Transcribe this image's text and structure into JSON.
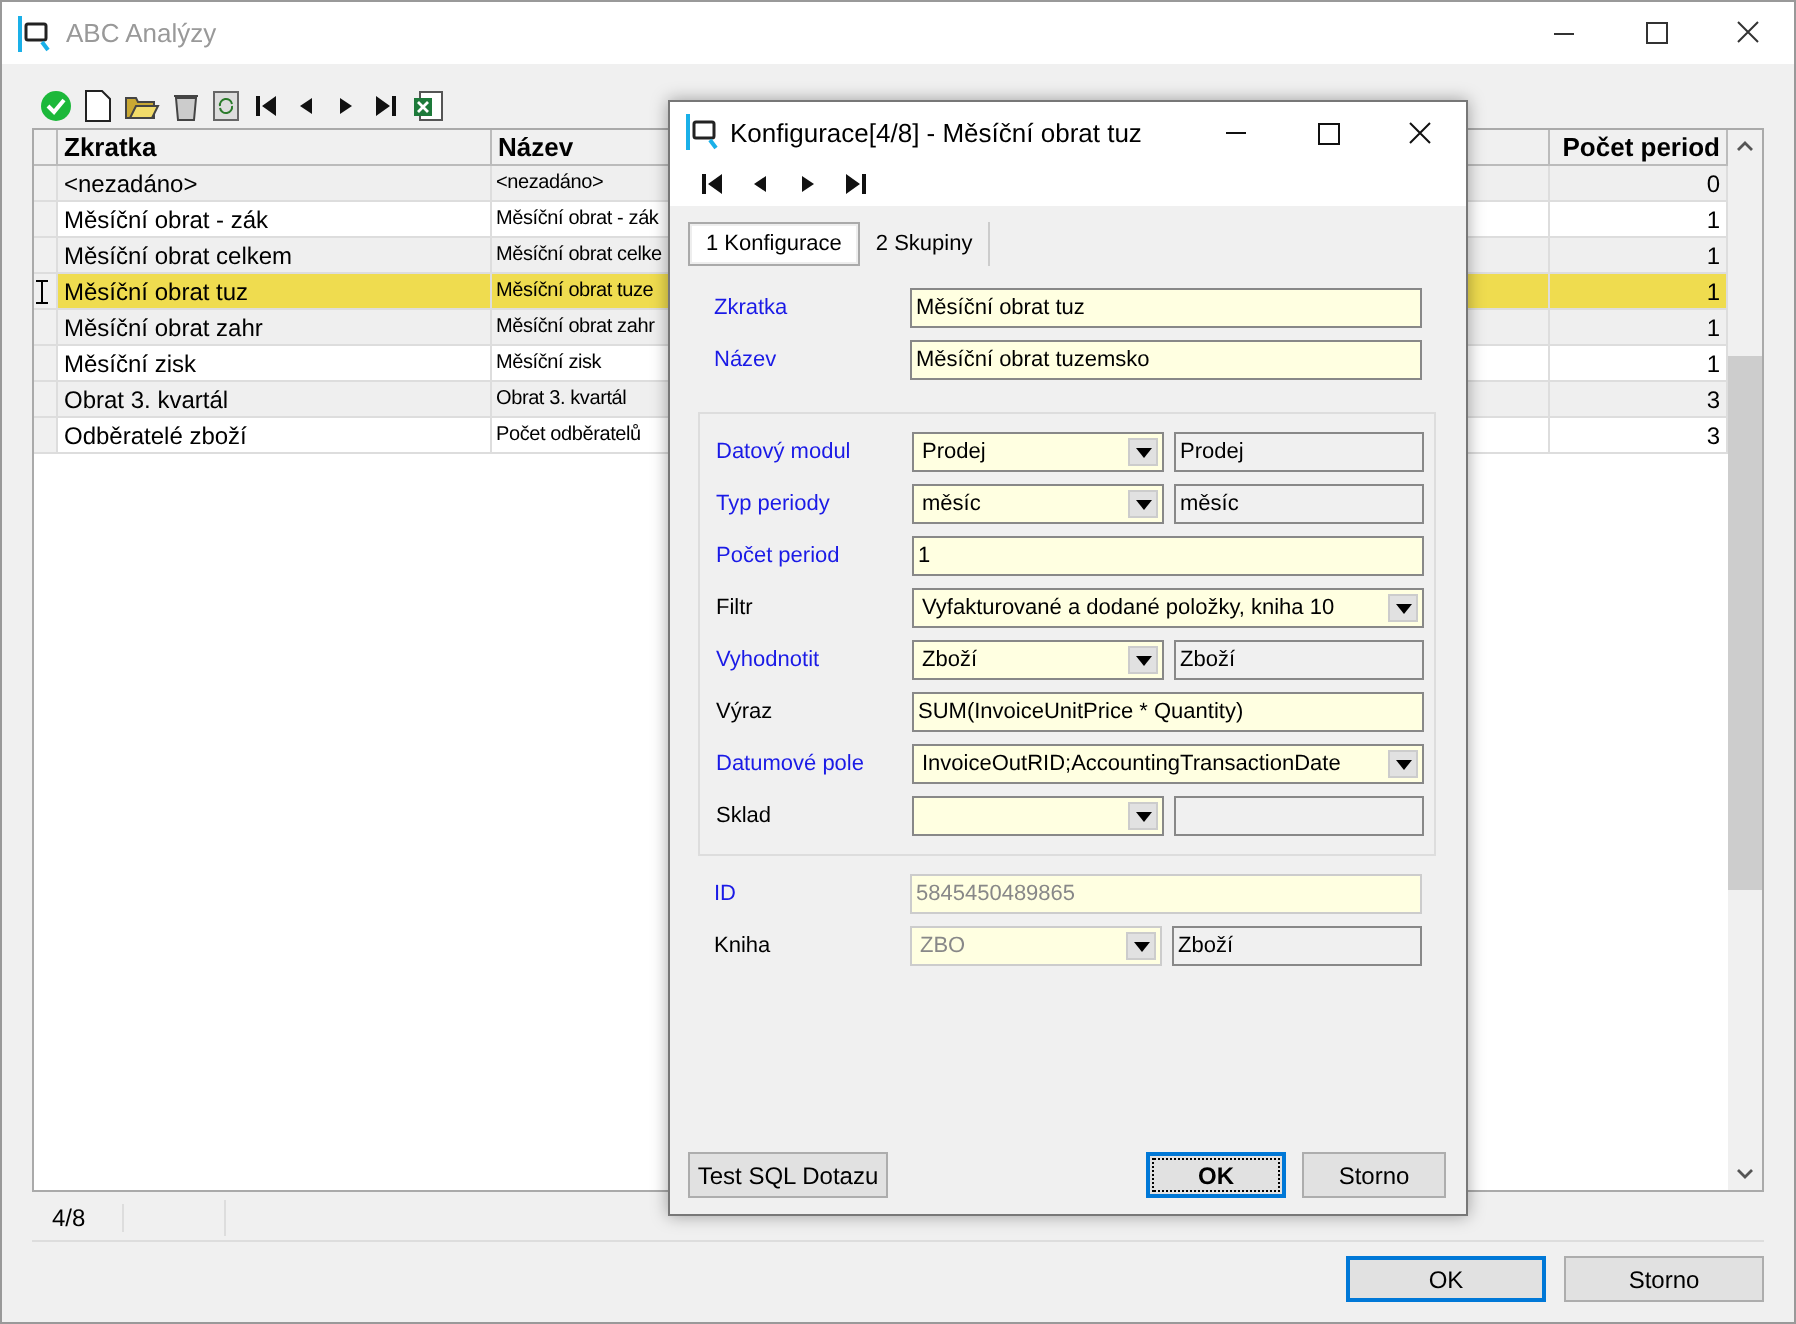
{
  "window": {
    "title": "ABC Analýzy"
  },
  "table": {
    "columns": [
      "Zkratka",
      "Název",
      "Počet period"
    ],
    "rows": [
      {
        "zkratka": "<nezadáno>",
        "nazev": "<nezadáno>",
        "pocet": "0",
        "selected": false
      },
      {
        "zkratka": "Měsíční obrat - zák",
        "nazev": "Měsíční obrat - zák",
        "pocet": "1",
        "selected": false
      },
      {
        "zkratka": "Měsíční obrat celkem",
        "nazev": "Měsíční obrat celke",
        "pocet": "1",
        "selected": false
      },
      {
        "zkratka": "Měsíční obrat tuz",
        "nazev": "Měsíční obrat tuze",
        "pocet": "1",
        "selected": true
      },
      {
        "zkratka": "Měsíční obrat zahr",
        "nazev": "Měsíční obrat zahr",
        "pocet": "1",
        "selected": false
      },
      {
        "zkratka": "Měsíční zisk",
        "nazev": "Měsíční zisk",
        "pocet": "1",
        "selected": false
      },
      {
        "zkratka": "Obrat 3. kvartál",
        "nazev": "Obrat 3. kvartál",
        "pocet": "3",
        "selected": false
      },
      {
        "zkratka": "Odběratelé zboží",
        "nazev": "Počet odběratelů",
        "pocet": "3",
        "selected": false
      }
    ]
  },
  "status_bar": {
    "position": "4/8"
  },
  "buttons": [
    "OK",
    "Storno"
  ],
  "dialog": {
    "title": "Konfigurace[4/8] - Měsíční obrat tuz",
    "tabs": [
      {
        "label": "1 Konfigurace",
        "selected": true
      },
      {
        "label": "2 Skupiny",
        "selected": false
      }
    ],
    "fields_top": [
      {
        "label": "Zkratka",
        "required": true,
        "kind": "text",
        "value": "Měsíční obrat tuz",
        "disabled": false
      },
      {
        "label": "Název",
        "required": true,
        "kind": "text",
        "value": "Měsíční obrat tuzemsko",
        "disabled": false
      }
    ],
    "group_fields": [
      {
        "label": "Datový modul",
        "required": true,
        "kind": "combo",
        "value": "Prodej",
        "side_value": "Prodej",
        "disabled": false
      },
      {
        "label": "Typ periody",
        "required": true,
        "kind": "combo",
        "value": "měsíc",
        "side_value": "měsíc",
        "disabled": false
      },
      {
        "label": "Počet period",
        "required": true,
        "kind": "text",
        "value": "1",
        "disabled": false
      },
      {
        "label": "Filtr",
        "required": false,
        "kind": "dropdown",
        "value": "Vyfakturované a dodané položky, kniha 10",
        "disabled": false
      },
      {
        "label": "Vyhodnotit",
        "required": true,
        "kind": "combo",
        "value": "Zboží",
        "side_value": "Zboží",
        "disabled": false
      },
      {
        "label": "Výraz",
        "required": false,
        "kind": "text",
        "value": "SUM(InvoiceUnitPrice * Quantity)",
        "disabled": false
      },
      {
        "label": "Datumové pole",
        "required": true,
        "kind": "dropdown",
        "value": "InvoiceOutRID;AccountingTransactionDate",
        "disabled": false
      },
      {
        "label": "Sklad",
        "required": false,
        "kind": "combo",
        "disabled": false
      }
    ],
    "fields_bottom": [
      {
        "label": "ID",
        "required": true,
        "kind": "text",
        "value": "5845450489865",
        "disabled": true
      },
      {
        "label": "Kniha",
        "required": false,
        "kind": "combo",
        "value": "ZBO",
        "side_value": "Zboží",
        "disabled": true
      }
    ],
    "test_button": "Test SQL Dotazu",
    "buttons": [
      "OK",
      "Storno"
    ]
  }
}
